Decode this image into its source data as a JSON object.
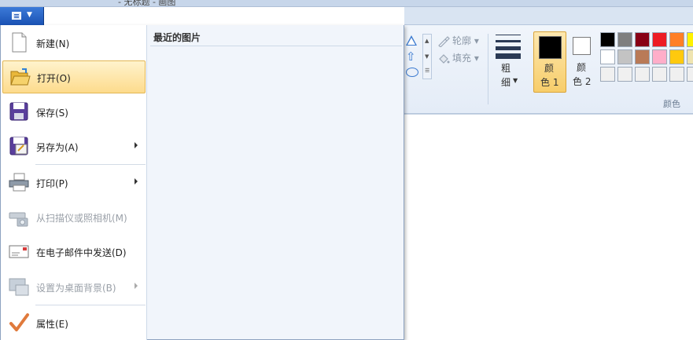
{
  "window": {
    "title_fragment": "- 无标题 - 画图"
  },
  "app_menu": {
    "items": [
      {
        "label": "新建(N)",
        "icon": "new-document-icon",
        "enabled": true,
        "submenu": false
      },
      {
        "label": "打开(O)",
        "icon": "open-folder-icon",
        "enabled": true,
        "submenu": false,
        "highlighted": true
      },
      {
        "label": "保存(S)",
        "icon": "save-floppy-icon",
        "enabled": true,
        "submenu": false
      },
      {
        "label": "另存为(A)",
        "icon": "save-as-icon",
        "enabled": true,
        "submenu": true
      },
      {
        "label": "打印(P)",
        "icon": "printer-icon",
        "enabled": true,
        "submenu": true
      },
      {
        "label": "从扫描仪或照相机(M)",
        "icon": "scanner-camera-icon",
        "enabled": false,
        "submenu": false
      },
      {
        "label": "在电子邮件中发送(D)",
        "icon": "email-icon",
        "enabled": true,
        "submenu": false
      },
      {
        "label": "设置为桌面背景(B)",
        "icon": "desktop-background-icon",
        "enabled": false,
        "submenu": true
      },
      {
        "label": "属性(E)",
        "icon": "properties-check-icon",
        "enabled": true,
        "submenu": false
      }
    ],
    "recent_title": "最近的图片"
  },
  "ribbon": {
    "outline_label": "轮廓",
    "fill_label": "填充",
    "size_label_1": "粗",
    "size_label_2": "细",
    "color1_label_1": "颜",
    "color1_label_2": "色 1",
    "color2_label_1": "颜",
    "color2_label_2": "色 2",
    "colors_group_label": "颜色",
    "color1_value": "#000000",
    "color2_value": "#ffffff",
    "palette_row1": [
      "#000000",
      "#7f7f7f",
      "#880015",
      "#ed1c24",
      "#ff7f27",
      "#fff200"
    ],
    "palette_row2": [
      "#ffffff",
      "#c3c3c3",
      "#b97a57",
      "#ffaec9",
      "#ffc90e",
      "#efe4b0"
    ],
    "palette_row3": [
      "#f0f0f0",
      "#f0f0f0",
      "#f0f0f0",
      "#f0f0f0",
      "#f0f0f0",
      "#f0f0f0"
    ]
  }
}
